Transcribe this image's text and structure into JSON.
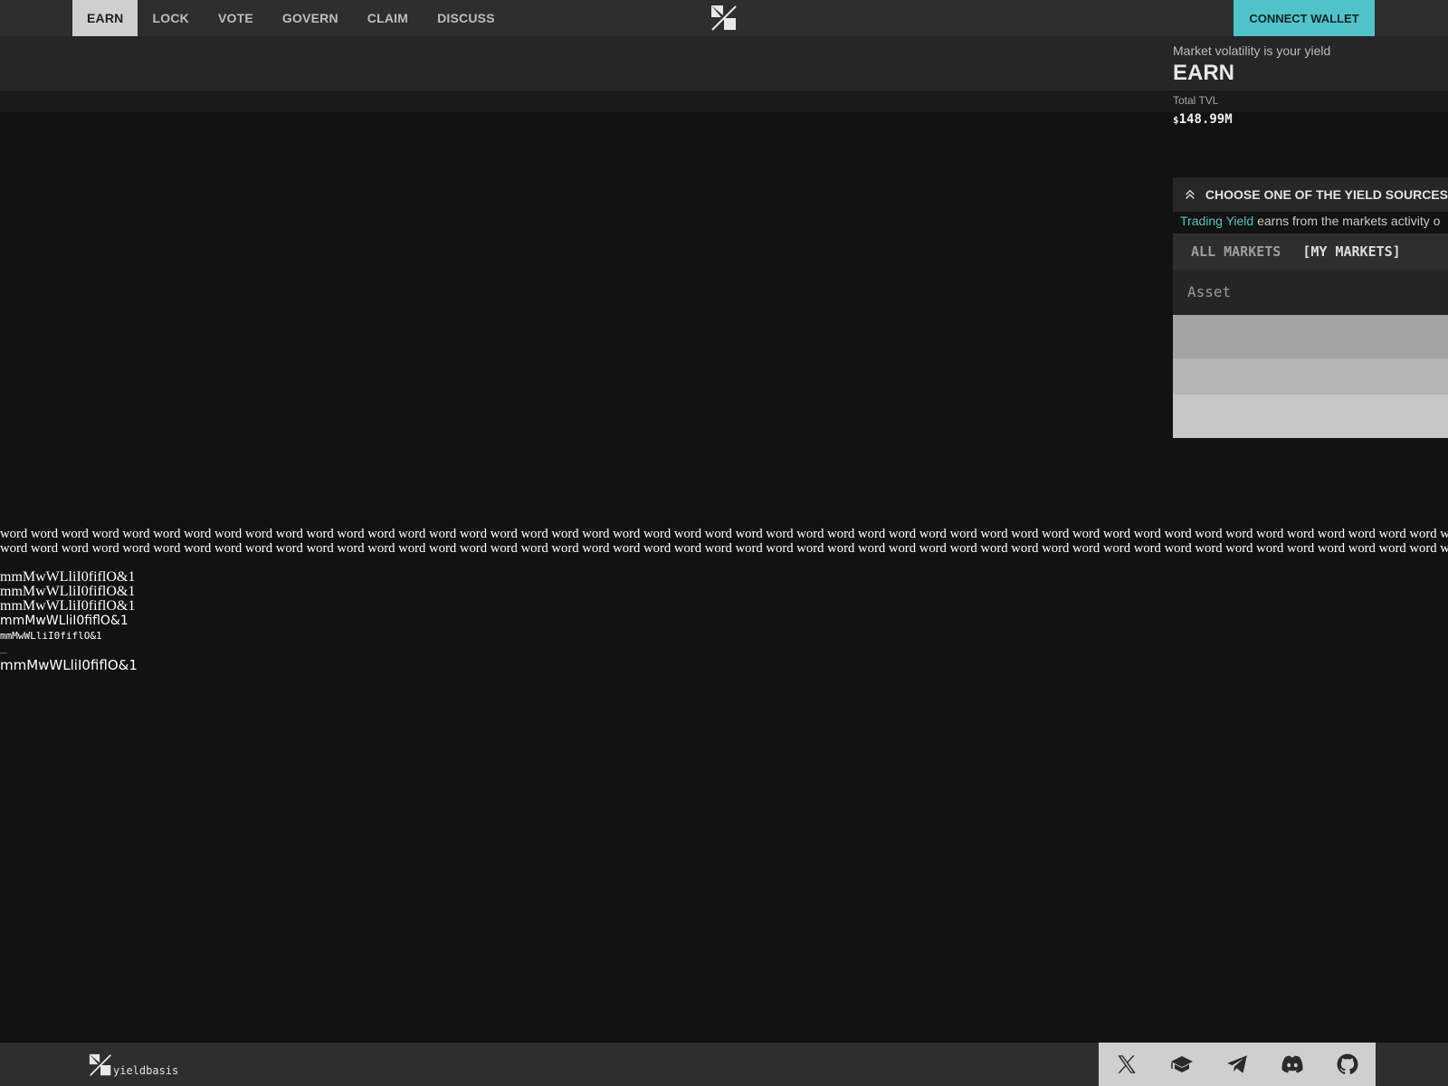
{
  "nav": {
    "tabs": [
      {
        "label": "EARN",
        "active": true
      },
      {
        "label": "LOCK"
      },
      {
        "label": "VOTE"
      },
      {
        "label": "GOVERN"
      },
      {
        "label": "CLAIM"
      },
      {
        "label": "DISCUSS"
      }
    ],
    "connect_label": "CONNECT WALLET"
  },
  "earn": {
    "tagline": "Market volatility is your yield",
    "title": "EARN",
    "tvl_label": "Total TVL",
    "tvl_currency": "$",
    "tvl_value": "148.99M"
  },
  "yield_panel": {
    "heading": "CHOOSE ONE OF THE YIELD SOURCES",
    "link_text": "Trading Yield",
    "desc_rest": " earns from the markets activity o",
    "tabs": [
      "ALL MARKETS",
      "[MY MARKETS]"
    ],
    "asset_label": "Asset"
  },
  "font_test": {
    "words_line": "word word word word word word word word word word word word word word word word word word word word word word word word word word word word word word word word word word word word word word word word word word word word word word word word word",
    "sample": "mmMwWLliI0fiflO&1",
    "dash": "__"
  },
  "footer": {
    "brand": "yieldbasis",
    "socials": [
      "x-icon",
      "book-icon",
      "telegram-icon",
      "discord-icon",
      "github-icon"
    ]
  },
  "colors": {
    "accent": "#4fc3c9",
    "background": "#121211",
    "bar": "#2e2e2e"
  }
}
